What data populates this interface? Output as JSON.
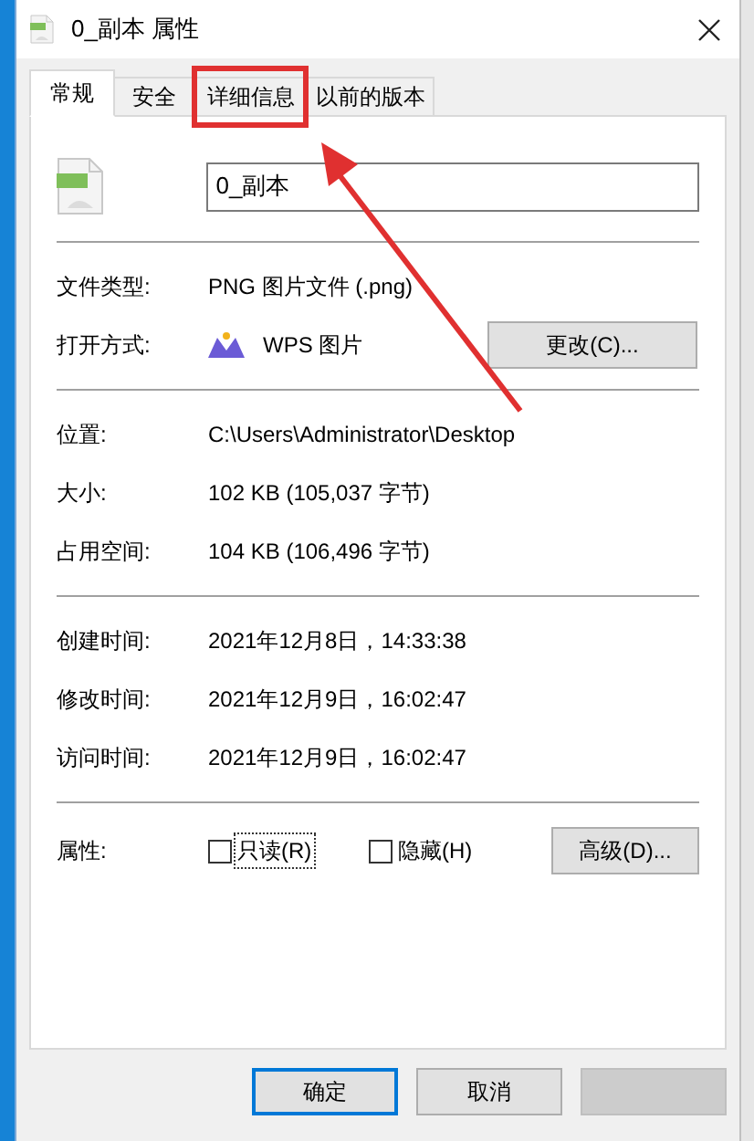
{
  "window": {
    "title": "0_副本 属性"
  },
  "tabs": [
    {
      "label": "常规",
      "selected": true
    },
    {
      "label": "安全",
      "selected": false
    },
    {
      "label": "详细信息",
      "selected": false
    },
    {
      "label": "以前的版本",
      "selected": false
    }
  ],
  "file_name": {
    "value": "0_副本"
  },
  "sections": [
    {
      "rows": [
        {
          "kind": "text",
          "label": "文件类型:",
          "value": "PNG 图片文件 (.png)"
        },
        {
          "kind": "app",
          "label": "打开方式:",
          "value": "WPS 图片",
          "button": "更改(C)..."
        }
      ]
    },
    {
      "rows": [
        {
          "kind": "text",
          "label": "位置:",
          "value": "C:\\Users\\Administrator\\Desktop"
        },
        {
          "kind": "text",
          "label": "大小:",
          "value": "102 KB (105,037 字节)"
        },
        {
          "kind": "text",
          "label": "占用空间:",
          "value": "104 KB (106,496 字节)"
        }
      ]
    },
    {
      "rows": [
        {
          "kind": "text",
          "label": "创建时间:",
          "value": "2021年12月8日，14:33:38"
        },
        {
          "kind": "text",
          "label": "修改时间:",
          "value": "2021年12月9日，16:02:47"
        },
        {
          "kind": "text",
          "label": "访问时间:",
          "value": "2021年12月9日，16:02:47"
        }
      ]
    }
  ],
  "attributes": {
    "label": "属性:",
    "button": "高级(D)...",
    "checkboxes": [
      {
        "label": "只读(R)",
        "checked": false,
        "focused": true
      },
      {
        "label": "隐藏(H)",
        "checked": false,
        "focused": false
      }
    ]
  },
  "buttons": [
    {
      "label": "确定",
      "default": true
    },
    {
      "label": "取消",
      "default": false
    }
  ],
  "apply_button": {
    "disabled": true
  }
}
